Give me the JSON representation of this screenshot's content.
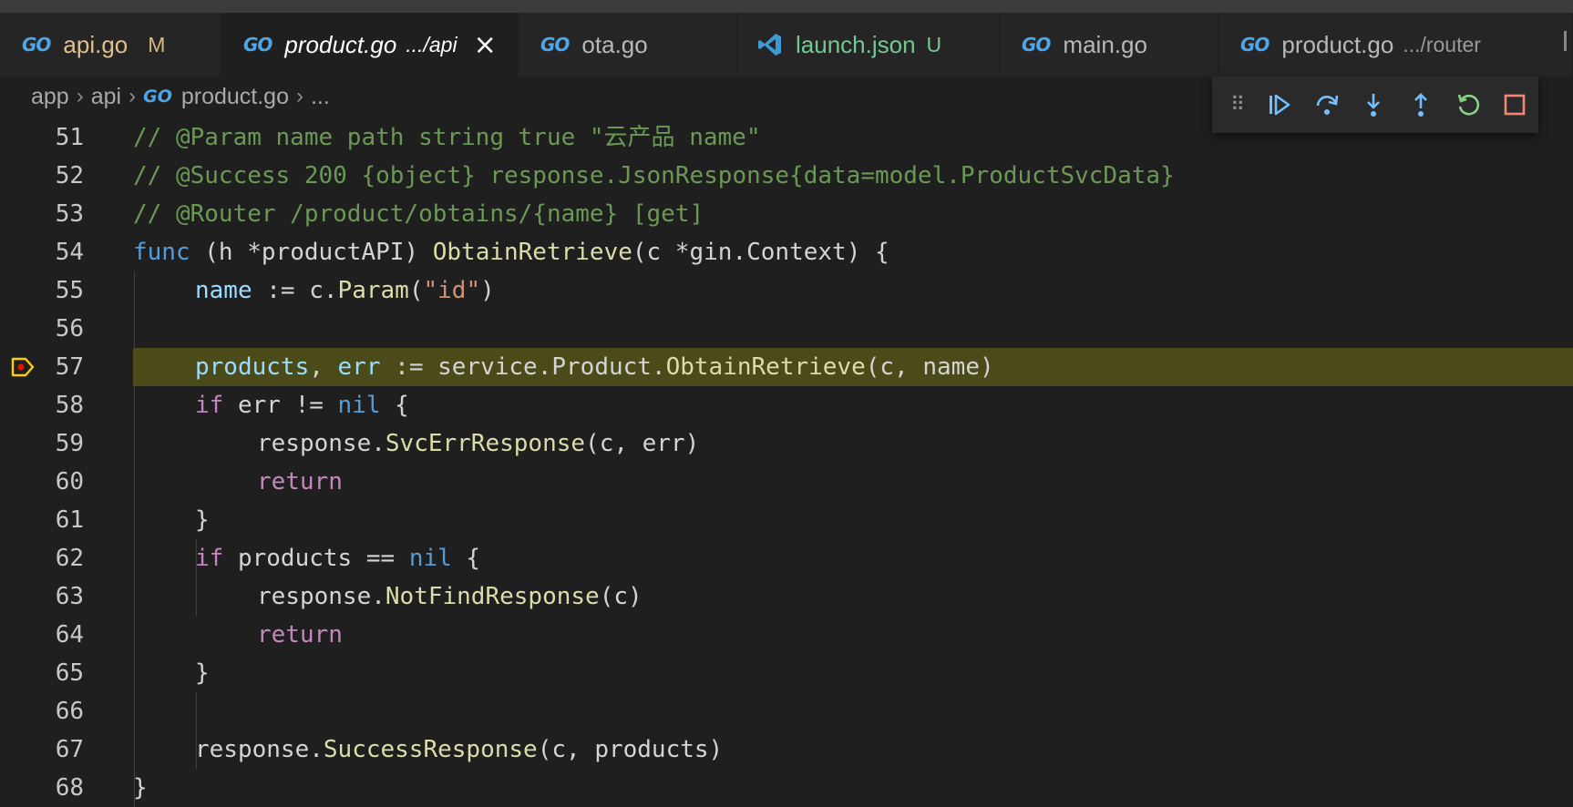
{
  "tabs": [
    {
      "name": "api.go",
      "badge": "M"
    },
    {
      "name": "product.go",
      "path": ".../api",
      "active": true
    },
    {
      "name": "ota.go"
    },
    {
      "name": "launch.json",
      "badge": "U"
    },
    {
      "name": "main.go"
    },
    {
      "name": "product.go",
      "path": ".../router"
    }
  ],
  "go_icon_text": "GO",
  "breadcrumb": {
    "parts": [
      "app",
      "api",
      "product.go",
      "..."
    ]
  },
  "debug_toolbar": {
    "buttons": [
      "continue-icon",
      "step-over-icon",
      "step-into-icon",
      "step-out-icon",
      "restart-icon",
      "stop-icon"
    ],
    "colors": {
      "accent": "#75beff",
      "restart": "#89d185",
      "stop": "#f48771"
    }
  },
  "editor": {
    "current_line": 57,
    "line_numbers": [
      "51",
      "52",
      "53",
      "54",
      "55",
      "56",
      "57",
      "58",
      "59",
      "60",
      "61",
      "62",
      "63",
      "64",
      "65",
      "66",
      "67",
      "68"
    ],
    "lines": {
      "l51": "// @Param name path string true \"云产品 name\"",
      "l52": "// @Success 200 {object} response.JsonResponse{data=model.ProductSvcData}",
      "l53": "// @Router /product/obtains/{name} [get]",
      "l54": {
        "func": "func",
        "recv": " (h *productAPI) ",
        "name": "ObtainRetrieve",
        "rest": "(c *gin.Context) {"
      },
      "l55": {
        "var": "name",
        "op": " := c.",
        "fn": "Param",
        "p1": "(",
        "str": "\"id\"",
        "p2": ")"
      },
      "l57": {
        "v1": "products",
        "c1": ", ",
        "v2": "err",
        "rest1": " := service.Product.",
        "fn": "ObtainRetrieve",
        "rest2": "(c, name)"
      },
      "l58": {
        "kw": "if",
        "mid": " err != ",
        "nil": "nil",
        "end": " {"
      },
      "l59": {
        "pre": "response.",
        "fn": "SvcErrResponse",
        "post": "(c, err)"
      },
      "l60": "return",
      "l61": "}",
      "l62": {
        "kw": "if",
        "mid": " products == ",
        "nil": "nil",
        "end": " {"
      },
      "l63": {
        "pre": "response.",
        "fn": "NotFindResponse",
        "post": "(c)"
      },
      "l64": "return",
      "l65": "}",
      "l67": {
        "pre": "response.",
        "fn": "SuccessResponse",
        "post": "(c, products)"
      },
      "l68": "}"
    }
  },
  "colors": {
    "highlight": "#4b4b1a",
    "breakpoint": "#ffcc00",
    "go_icon": "#4fa6e6"
  }
}
